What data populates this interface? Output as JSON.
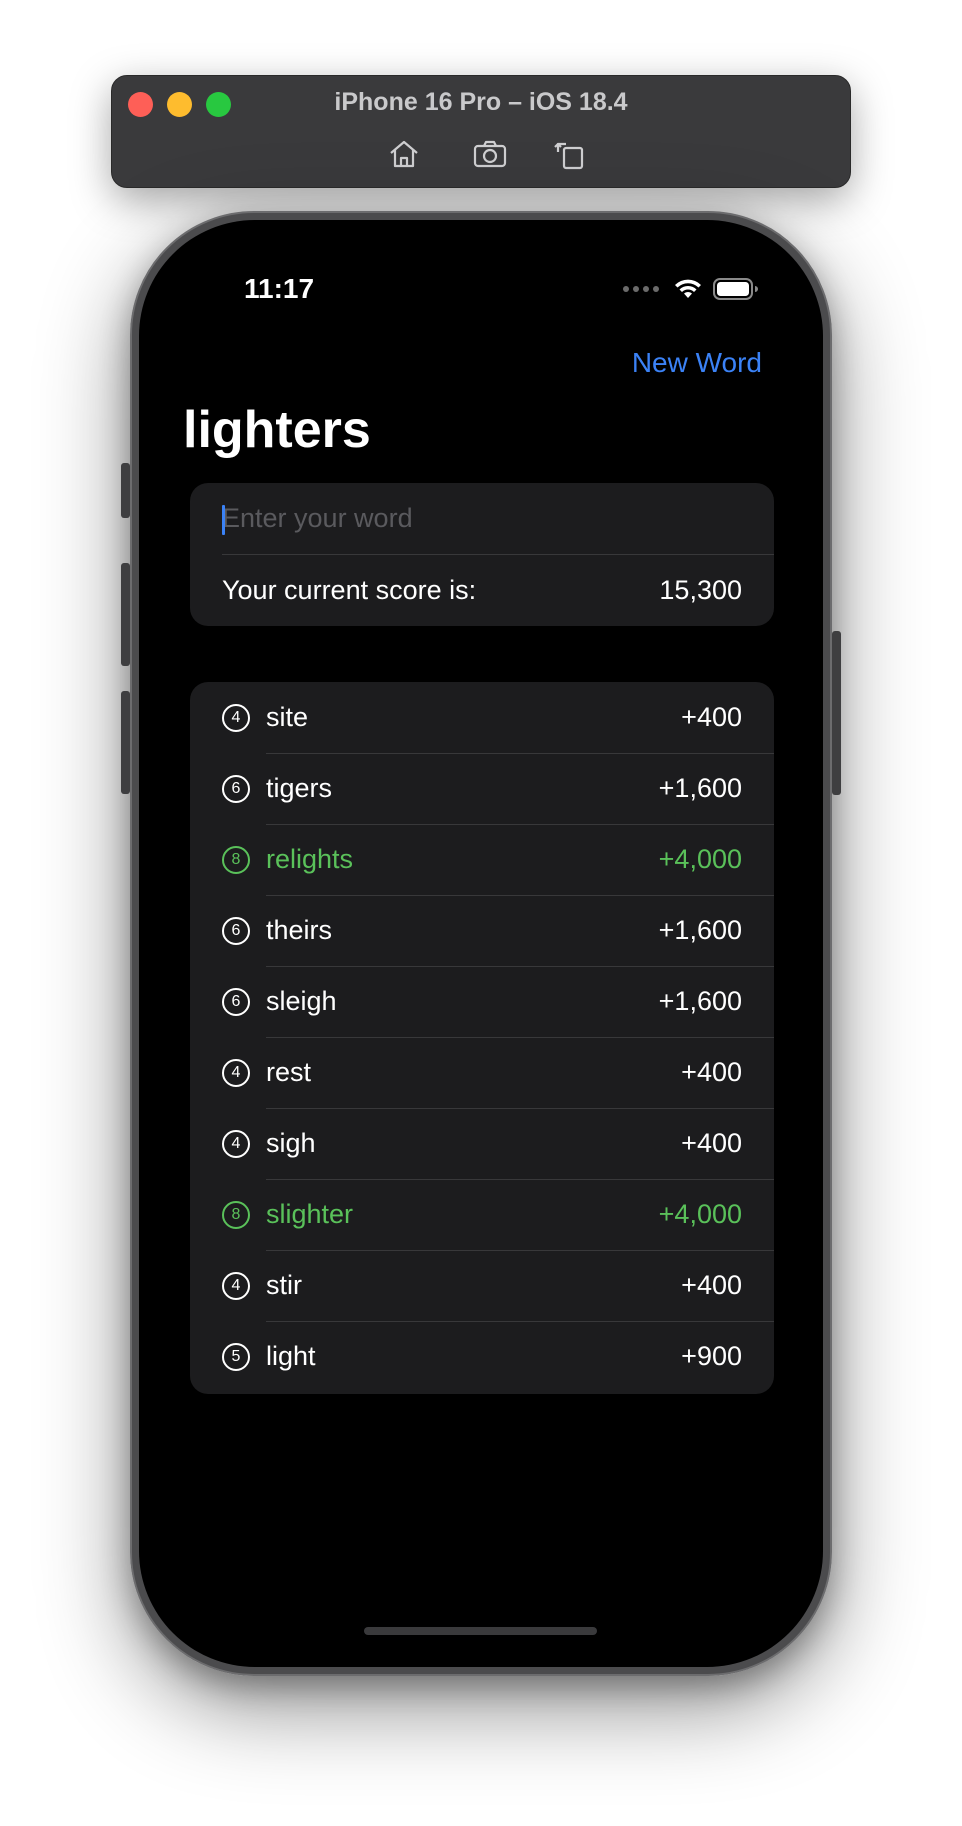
{
  "simulator": {
    "title": "iPhone 16 Pro – iOS 18.4",
    "tools": [
      "home-icon",
      "screenshot-icon",
      "rotate-icon"
    ]
  },
  "status_bar": {
    "time": "11:17",
    "icons": [
      "cellular-icon",
      "wifi-icon",
      "battery-icon"
    ]
  },
  "nav": {
    "new_word_label": "New Word",
    "title": "lighters"
  },
  "input": {
    "placeholder": "Enter your word",
    "value": ""
  },
  "score": {
    "label": "Your current score is:",
    "value": "15,300"
  },
  "colors": {
    "accent": "#3b82f6",
    "highlight": "#5ac15a",
    "card": "#1c1c1e",
    "background": "#000000"
  },
  "words": [
    {
      "length": "4",
      "word": "site",
      "points": "+400",
      "highlight": false
    },
    {
      "length": "6",
      "word": "tigers",
      "points": "+1,600",
      "highlight": false
    },
    {
      "length": "8",
      "word": "relights",
      "points": "+4,000",
      "highlight": true
    },
    {
      "length": "6",
      "word": "theirs",
      "points": "+1,600",
      "highlight": false
    },
    {
      "length": "6",
      "word": "sleigh",
      "points": "+1,600",
      "highlight": false
    },
    {
      "length": "4",
      "word": "rest",
      "points": "+400",
      "highlight": false
    },
    {
      "length": "4",
      "word": "sigh",
      "points": "+400",
      "highlight": false
    },
    {
      "length": "8",
      "word": "slighter",
      "points": "+4,000",
      "highlight": true
    },
    {
      "length": "4",
      "word": "stir",
      "points": "+400",
      "highlight": false
    },
    {
      "length": "5",
      "word": "light",
      "points": "+900",
      "highlight": false
    }
  ]
}
